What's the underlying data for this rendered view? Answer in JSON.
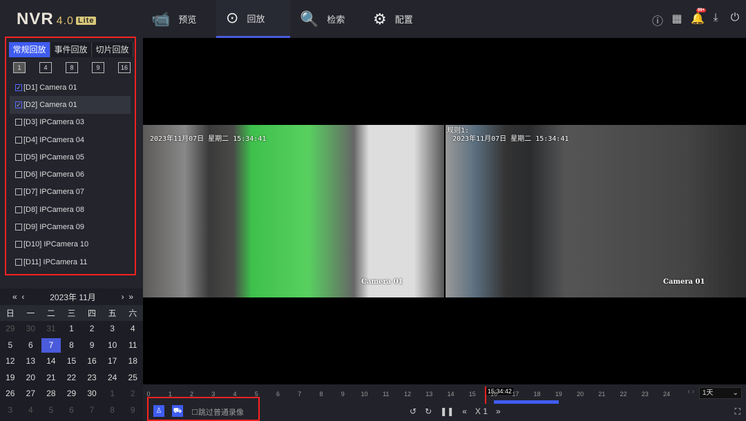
{
  "header": {
    "logo": "NVR",
    "version": "4.0",
    "edition": "Lite",
    "nav": [
      {
        "label": "预览",
        "icon": "camera-icon"
      },
      {
        "label": "回放",
        "icon": "playback-icon",
        "active": true
      },
      {
        "label": "检索",
        "icon": "search-doc-icon"
      },
      {
        "label": "配置",
        "icon": "gear-icon"
      }
    ],
    "notification_badge": "99+"
  },
  "sidebar": {
    "tabs": [
      "常规回放",
      "事件回放",
      "切片回放"
    ],
    "active_tab": 0,
    "splits": [
      "1",
      "4",
      "8",
      "9",
      "16"
    ],
    "cameras": [
      {
        "label": "[D1] Camera 01",
        "checked": true
      },
      {
        "label": "[D2] Camera 01",
        "checked": true
      },
      {
        "label": "[D3] IPCamera 03",
        "checked": false
      },
      {
        "label": "[D4] IPCamera 04",
        "checked": false
      },
      {
        "label": "[D5] IPCamera 05",
        "checked": false
      },
      {
        "label": "[D6] IPCamera 06",
        "checked": false
      },
      {
        "label": "[D7] IPCamera 07",
        "checked": false
      },
      {
        "label": "[D8] IPCamera 08",
        "checked": false
      },
      {
        "label": "[D9] IPCamera 09",
        "checked": false
      },
      {
        "label": "[D10] IPCamera 10",
        "checked": false
      },
      {
        "label": "[D11] IPCamera 11",
        "checked": false
      }
    ]
  },
  "calendar": {
    "title": "2023年 11月",
    "weekdays": [
      "日",
      "一",
      "二",
      "三",
      "四",
      "五",
      "六"
    ],
    "days": [
      "29",
      "30",
      "31",
      "1",
      "2",
      "3",
      "4",
      "5",
      "6",
      "7",
      "8",
      "9",
      "10",
      "11",
      "12",
      "13",
      "14",
      "15",
      "16",
      "17",
      "18",
      "19",
      "20",
      "21",
      "22",
      "23",
      "24",
      "25",
      "26",
      "27",
      "28",
      "29",
      "30",
      "1",
      "2",
      "3",
      "4",
      "5",
      "6",
      "7",
      "8",
      "9"
    ],
    "selected": "7"
  },
  "videos": [
    {
      "osd": "2023年11月07日 星期二 15:34:41",
      "label": "Camera 01"
    },
    {
      "osd_rule": "规则1:",
      "osd": "2023年11月07日 星期二 15:34:41",
      "label": "Camera 01"
    }
  ],
  "timeline": {
    "hours": [
      "0",
      "1",
      "2",
      "3",
      "4",
      "5",
      "6",
      "7",
      "8",
      "9",
      "10",
      "11",
      "12",
      "13",
      "14",
      "15",
      "16",
      "17",
      "18",
      "19",
      "20",
      "21",
      "22",
      "23",
      "24"
    ],
    "current_time": "15:34:42",
    "current_hour": 15.58,
    "recording": [
      16,
      19
    ],
    "range": "1天",
    "skip_label": "跳过普通录像",
    "speed": "X 1"
  },
  "colors": {
    "accent": "#3f5cf0",
    "highlight": "#ff2222"
  }
}
